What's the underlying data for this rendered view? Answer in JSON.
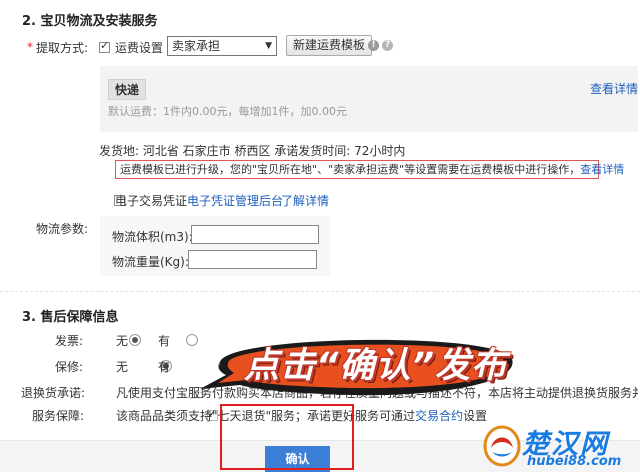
{
  "logistics": {
    "section_title": "2. 宝贝物流及安装服务",
    "required_mark": "*",
    "pickup_label": "提取方式:",
    "shipping_setting_label": "运费设置",
    "carrier_select_value": "卖家承担",
    "new_template_button": "新建运费模板",
    "template_name": "快递",
    "view_details": "查看详情",
    "default_fee_text": "默认运费：1件内0.00元，每增加1件，加0.00元",
    "ship_from_text": "发货地: 河北省 石家庄市 桥西区 承诺发货时间: 72小时内",
    "notice_text": "运费模板已进行升级，您的\"宝贝所在地\"、\"卖家承担运费\"等设置需要在运费模板中进行操作，",
    "notice_link": "查看详情",
    "e_voucher_label": "电子交易凭证",
    "e_voucher_admin_link": "电子凭证管理后台",
    "learn_more_link": "了解详情",
    "params_label": "物流参数:",
    "volume_label": "物流体积(m3):",
    "volume_value": "",
    "weight_label": "物流重量(Kg):",
    "weight_value": ""
  },
  "after_sales": {
    "section_title": "3. 售后保障信息",
    "invoice_label": "发票:",
    "warranty_label": "保修:",
    "option_no": "无",
    "option_yes": "有",
    "return_label": "退换货承诺:",
    "return_text": "凡使用支付宝服务付款购买本店商品，若存在质量问题或与描述不符，本店将主动提供退换货服务并承担来回邮费!",
    "service_label": "服务保障:",
    "service_text_before": "该商品品类须支持\"七天退货\"服务；承诺更好服务可通过",
    "service_link": "交易合约",
    "service_text_after": "设置"
  },
  "overlay": {
    "caption": "点击“确认”发布"
  },
  "footer": {
    "confirm_button": "确认"
  },
  "watermark": {
    "cn": "楚汉网",
    "en": "hubei88.com"
  },
  "colors": {
    "link": "#1f5fbd",
    "notice_border": "#e05555",
    "confirm_bg": "#3c7fd6",
    "highlight_frame": "#e02020",
    "bubble_fill": "#e8501f"
  }
}
